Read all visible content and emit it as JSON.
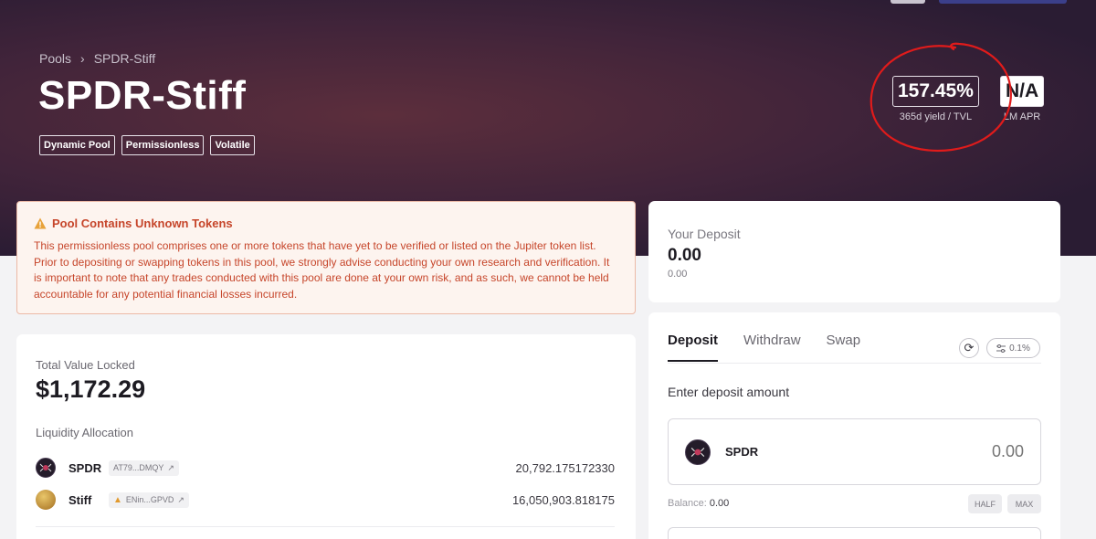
{
  "breadcrumb": {
    "root": "Pools",
    "current": "SPDR-Stiff"
  },
  "title": "SPDR-Stiff",
  "tags": [
    "Dynamic Pool",
    "Permissionless",
    "Volatile"
  ],
  "stats": {
    "yield_value": "157.45%",
    "yield_label": "365d yield / TVL",
    "lm_value": "N/A",
    "lm_label": "LM APR"
  },
  "alert": {
    "title": "Pool Contains Unknown Tokens",
    "body": "This permissionless pool comprises one or more tokens that have yet to be verified or listed on the Jupiter token list. Prior to depositing or swapping tokens in this pool, we strongly advise conducting your own research and verification. It is important to note that any trades conducted with this pool are done at your own risk, and as such, we cannot be held accountable for any potential financial losses incurred."
  },
  "your_deposit": {
    "label": "Your Deposit",
    "value": "0.00",
    "sub": "0.00"
  },
  "tvl": {
    "label": "Total Value Locked",
    "value": "$1,172.29"
  },
  "liquidity": {
    "label": "Liquidity Allocation",
    "tokens": [
      {
        "name": "SPDR",
        "address": "AT79...DMQY",
        "amount": "20,792.175172330"
      },
      {
        "name": "Stiff",
        "address": "ENin...GPVD",
        "amount": "16,050,903.818175"
      }
    ]
  },
  "trade": {
    "tabs": [
      "Deposit",
      "Withdraw",
      "Swap"
    ],
    "slippage": "0.1%",
    "enter_label": "Enter deposit amount",
    "token": "SPDR",
    "amount": "0.00",
    "balance_label": "Balance:",
    "balance_value": "0.00",
    "half": "HALF",
    "max": "MAX"
  },
  "colors": {
    "accent_red": "#c6452a",
    "annotation": "#e01b1b",
    "hero": "#41243a"
  }
}
